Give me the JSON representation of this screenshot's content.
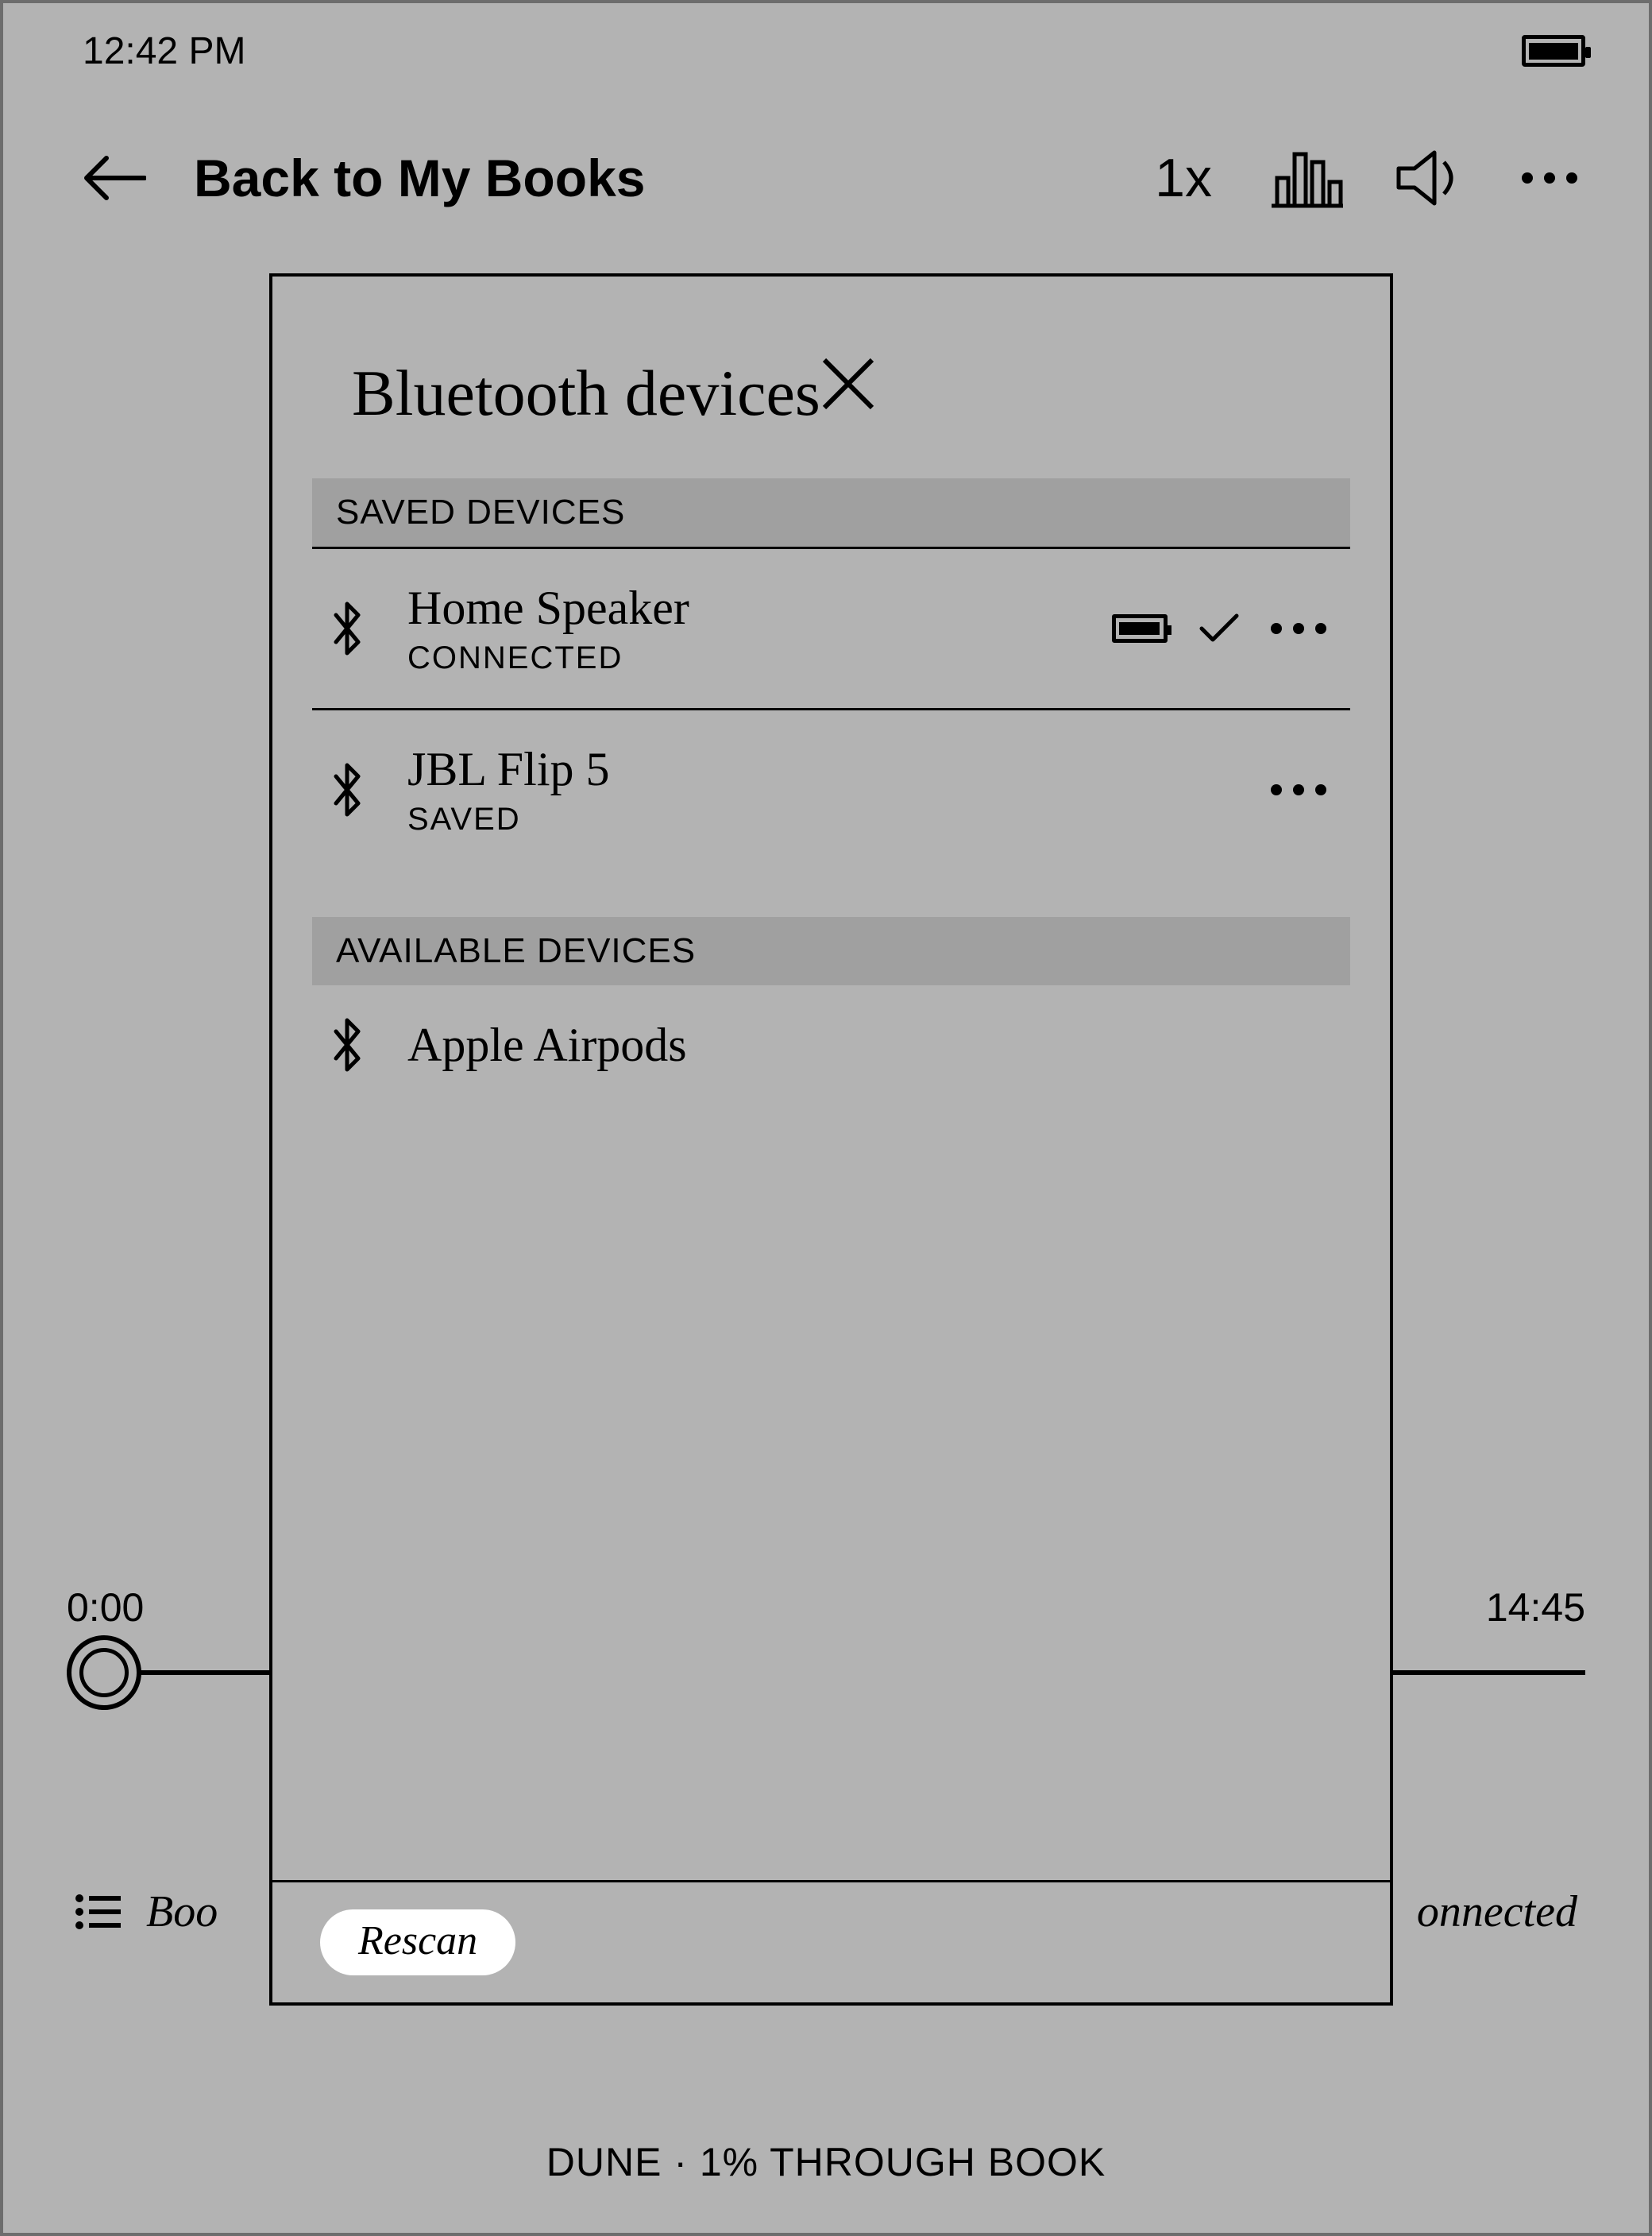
{
  "status": {
    "time": "12:42 PM"
  },
  "header": {
    "back_label": "Back to My Books",
    "speed": "1x"
  },
  "playback": {
    "elapsed": "0:00",
    "remaining": "14:45"
  },
  "bottom": {
    "left_partial": "Boo",
    "right_partial": "onnected"
  },
  "footer": {
    "text": "DUNE · 1% THROUGH BOOK"
  },
  "modal": {
    "title": "Bluetooth devices",
    "saved_header": "SAVED DEVICES",
    "available_header": "AVAILABLE DEVICES",
    "saved": [
      {
        "name": "Home Speaker",
        "status": "CONNECTED"
      },
      {
        "name": "JBL Flip 5",
        "status": "SAVED"
      }
    ],
    "available": [
      {
        "name": "Apple Airpods"
      }
    ],
    "rescan_label": "Rescan"
  }
}
